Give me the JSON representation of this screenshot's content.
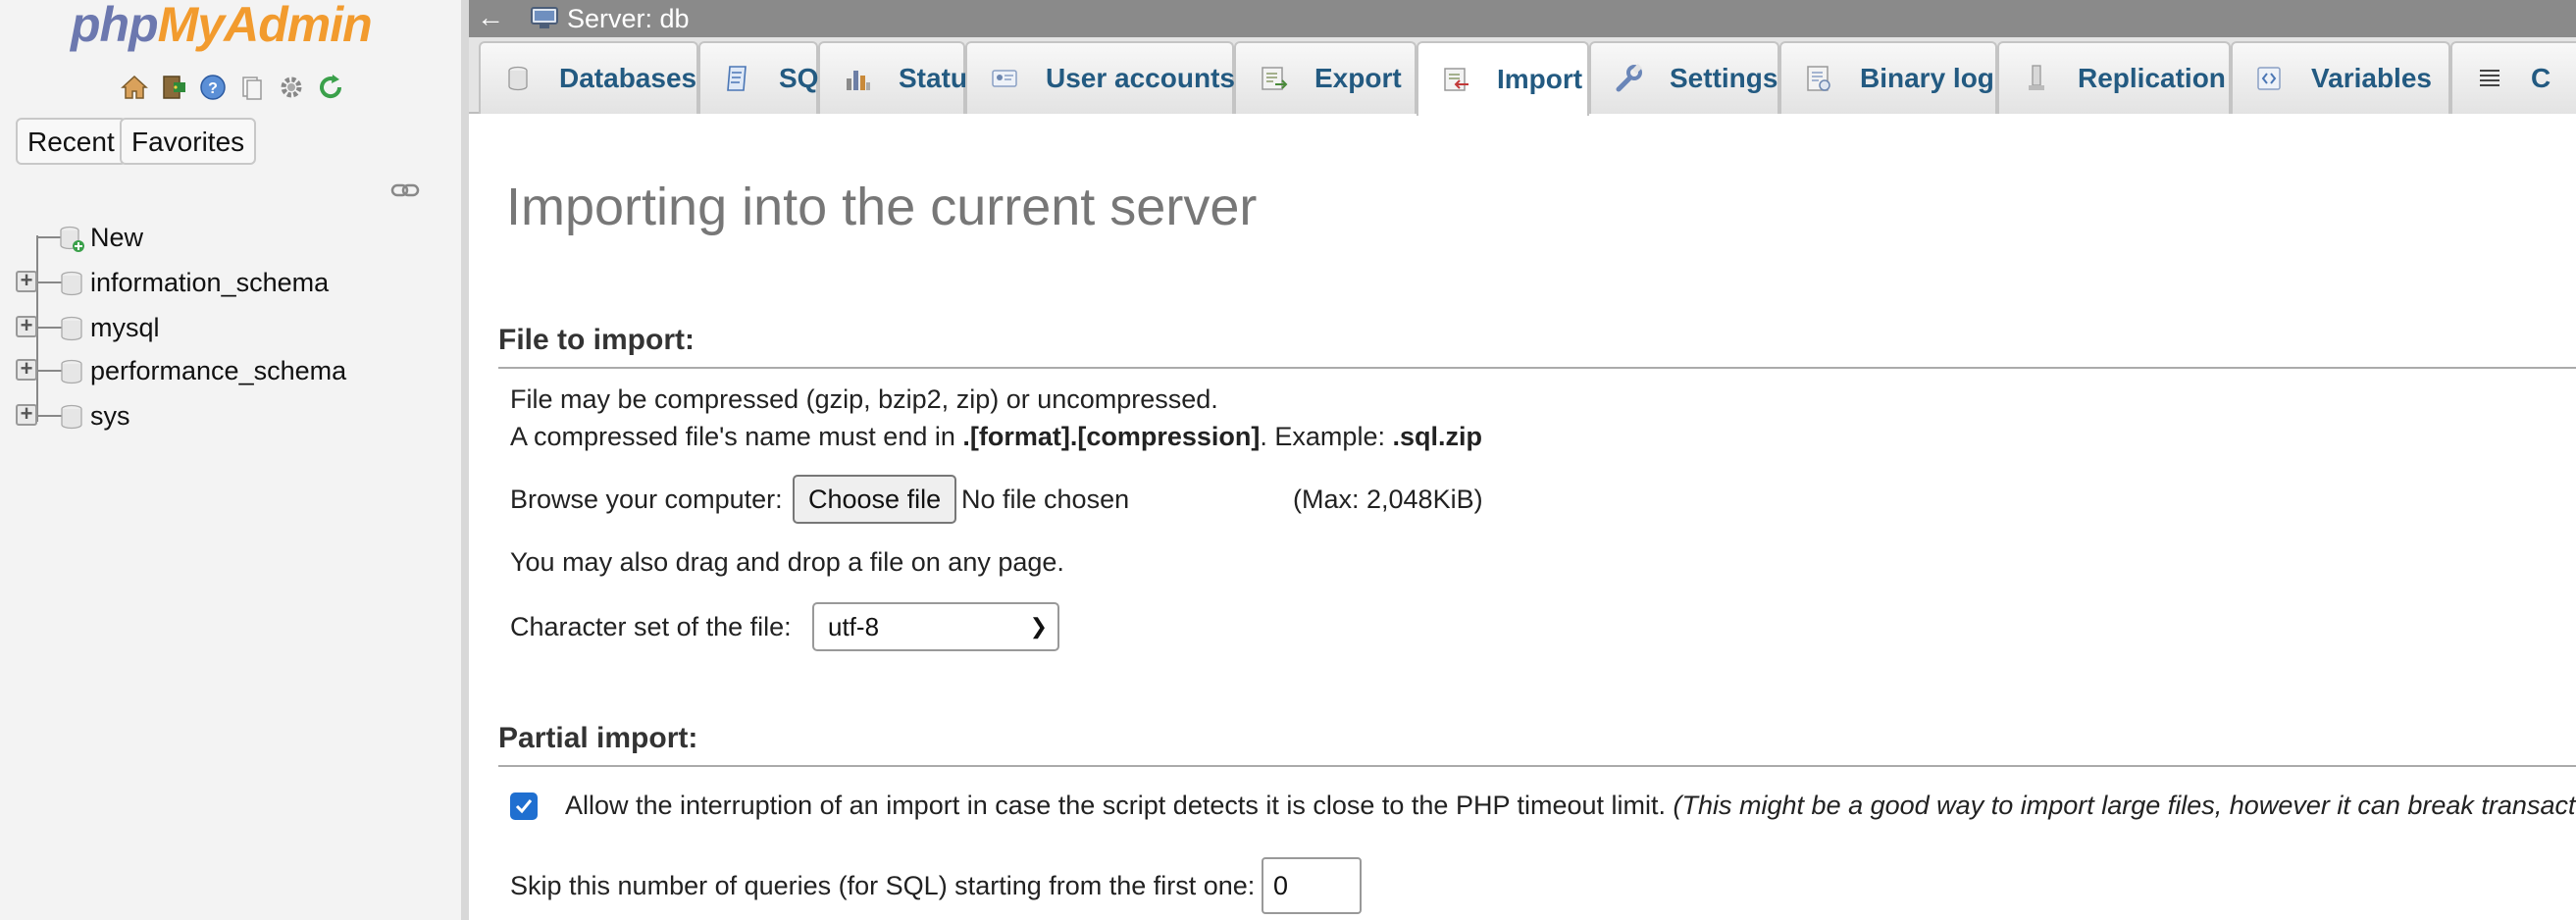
{
  "sidebar": {
    "logo_php": "php",
    "logo_admin": "MyAdmin",
    "nav_icons": [
      "home-icon",
      "logout-icon",
      "help-icon",
      "docs-icon",
      "settings-icon",
      "reload-icon"
    ],
    "tabs": {
      "recent": "Recent",
      "favorites": "Favorites"
    },
    "tree": [
      {
        "label": "New",
        "expandable": false
      },
      {
        "label": "information_schema",
        "expandable": true
      },
      {
        "label": "mysql",
        "expandable": true
      },
      {
        "label": "performance_schema",
        "expandable": true
      },
      {
        "label": "sys",
        "expandable": true
      }
    ]
  },
  "topbar": {
    "arrow": "←",
    "server_label": "Server: db"
  },
  "tabs": [
    {
      "label": "Databases",
      "icon": "database-icon",
      "active": false
    },
    {
      "label": "SQL",
      "icon": "sql-icon",
      "active": false
    },
    {
      "label": "Status",
      "icon": "status-icon",
      "active": false
    },
    {
      "label": "User accounts",
      "icon": "users-icon",
      "active": false
    },
    {
      "label": "Export",
      "icon": "export-icon",
      "active": false
    },
    {
      "label": "Import",
      "icon": "import-icon",
      "active": true
    },
    {
      "label": "Settings",
      "icon": "wrench-icon",
      "active": false
    },
    {
      "label": "Binary log",
      "icon": "binlog-icon",
      "active": false
    },
    {
      "label": "Replication",
      "icon": "replication-icon",
      "active": false
    },
    {
      "label": "Variables",
      "icon": "variables-icon",
      "active": false
    },
    {
      "label": "C",
      "icon": "charset-icon",
      "active": false
    }
  ],
  "main": {
    "page_title": "Importing into the current server",
    "file_section": {
      "header": "File to import:",
      "compress_note": "File may be compressed (gzip, bzip2, zip) or uncompressed.",
      "name_note_prefix": "A compressed file's name must end in ",
      "name_note_format": ".[format].[compression]",
      "name_note_mid": ". Example: ",
      "name_note_example": ".sql.zip",
      "browse_label": "Browse your computer:",
      "choose_button": "Choose file",
      "no_file": "No file chosen",
      "max_size": "(Max: 2,048KiB)",
      "drag_note": "You may also drag and drop a file on any page.",
      "charset_label": "Character set of the file:",
      "charset_value": "utf-8"
    },
    "partial_section": {
      "header": "Partial import:",
      "allow_interrupt_checked": true,
      "allow_interrupt_label": "Allow the interruption of an import in case the script detects it is close to the PHP timeout limit.",
      "allow_interrupt_note": "(This might be a good way to import large files, however it can break transactions.)",
      "skip_label": "Skip this number of queries (for SQL) starting from the first one:",
      "skip_value": "0"
    }
  },
  "colors": {
    "tab_text": "#235a81",
    "logo_php": "#6c78af",
    "logo_admin": "#f29b2e",
    "checkbox": "#1f6fd0"
  }
}
